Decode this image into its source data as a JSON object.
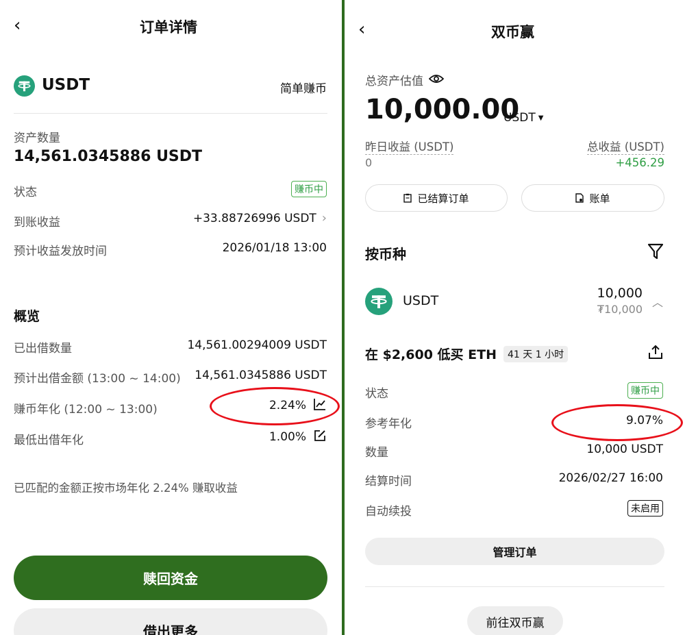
{
  "left": {
    "header": {
      "title": "订单详情"
    },
    "asset": {
      "symbol": "USDT",
      "product": "简单赚币"
    },
    "quantity": {
      "label": "资产数量",
      "value": "14,561.0345886 USDT"
    },
    "status": {
      "label": "状态",
      "badge": "赚币中"
    },
    "earnings": {
      "label": "到账收益",
      "value": "+33.88726996 USDT"
    },
    "payout": {
      "label": "预计收益发放时间",
      "value": "2026/01/18 13:00"
    },
    "overview": {
      "title": "概览",
      "rows": [
        {
          "label": "已出借数量",
          "value": "14,561.00294009 USDT"
        },
        {
          "label": "预计出借金额 (13:00 ~ 14:00)",
          "value": "14,561.0345886 USDT"
        },
        {
          "label": "赚币年化 (12:00 ~ 13:00)",
          "value": "2.24%"
        },
        {
          "label": "最低出借年化",
          "value": "1.00%"
        }
      ]
    },
    "note": "已匹配的金额正按市场年化 2.24% 赚取收益",
    "buttons": {
      "redeem": "赎回资金",
      "lend_more": "借出更多"
    }
  },
  "right": {
    "header": {
      "title": "双币赢"
    },
    "total": {
      "label": "总资产估值",
      "value": "10,000.00",
      "unit": "USDT"
    },
    "yesterday": {
      "label": "昨日收益 (USDT)",
      "value": "0"
    },
    "cumulative": {
      "label": "总收益 (USDT)",
      "value": "+456.29"
    },
    "tabs": {
      "settled": "已结算订单",
      "bill": "账单"
    },
    "section_title": "按币种",
    "coin": {
      "symbol": "USDT",
      "amount": "10,000",
      "fiat": "₮10,000"
    },
    "order": {
      "title": "在 $2,600 低买 ETH",
      "duration": "41 天 1 小时",
      "rows": [
        {
          "label": "状态",
          "badge": "赚币中"
        },
        {
          "label": "参考年化",
          "value": "9.07%"
        },
        {
          "label": "数量",
          "value": "10,000 USDT"
        },
        {
          "label": "结算时间",
          "value": "2026/02/27 16:00"
        },
        {
          "label": "自动续投",
          "badge": "未启用"
        }
      ]
    },
    "buttons": {
      "manage": "管理订单",
      "goto": "前往双币赢"
    }
  },
  "colors": {
    "accent_green": "#2f6e1f",
    "positive_green": "#2f9e44",
    "highlight_red": "#e8101a",
    "tether": "#26a17b"
  }
}
